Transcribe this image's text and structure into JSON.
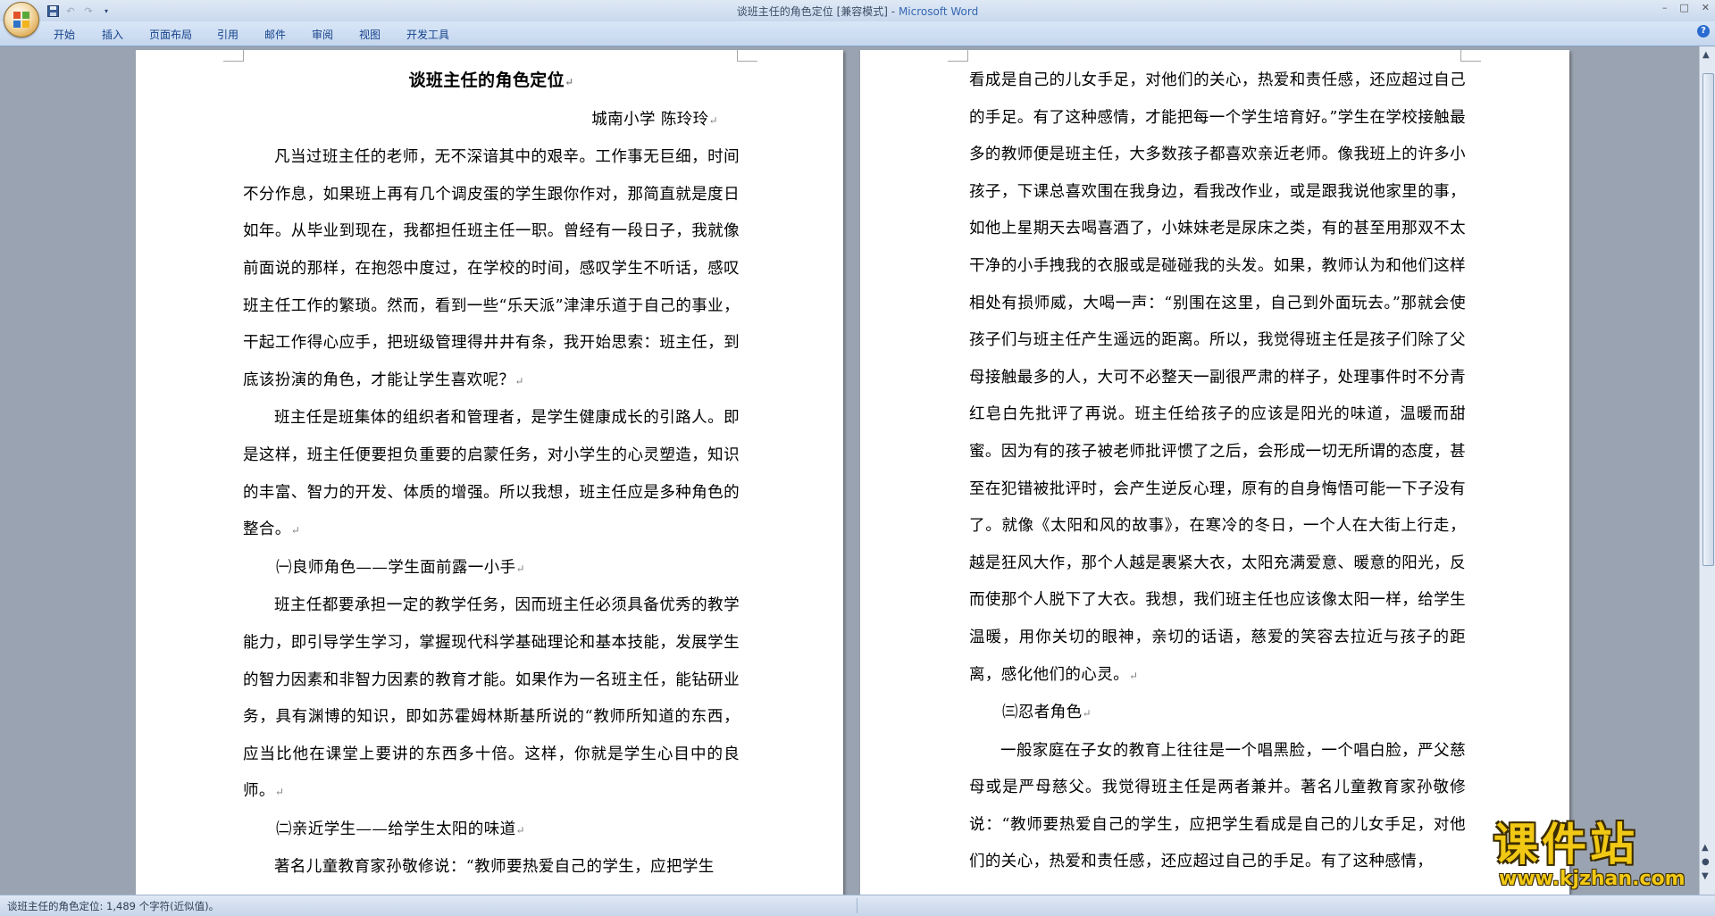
{
  "window": {
    "title_doc": "谈班主任的角色定位 [兼容模式]",
    "title_sep": " - ",
    "title_app": "Microsoft Word"
  },
  "ribbon": {
    "tabs": [
      "开始",
      "插入",
      "页面布局",
      "引用",
      "邮件",
      "审阅",
      "视图",
      "开发工具"
    ]
  },
  "quick_access": {
    "icons": [
      "save-icon",
      "undo-icon",
      "redo-icon",
      "customize-dropdown-icon"
    ]
  },
  "paragraph_mark": "↵",
  "page1": {
    "title": "谈班主任的角色定位",
    "author": "城南小学  陈玲玲",
    "para1": "凡当过班主任的老师，无不深谙其中的艰辛。工作事无巨细，时间不分作息，如果班上再有几个调皮蛋的学生跟你作对，那简直就是度日如年。从毕业到现在，我都担任班主任一职。曾经有一段日子，我就像前面说的那样，在抱怨中度过，在学校的时间，感叹学生不听话，感叹班主任工作的繁琐。然而，看到一些“乐天派”津津乐道于自己的事业，干起工作得心应手，把班级管理得井井有条，我开始思索：班主任，到底该扮演的角色，才能让学生喜欢呢？",
    "para2": "班主任是班集体的组织者和管理者，是学生健康成长的引路人。即是这样，班主任便要担负重要的启蒙任务，对小学生的心灵塑造，知识的丰富、智力的开发、体质的增强。所以我想，班主任应是多种角色的整合。",
    "heading1": "㈠良师角色——学生面前露一小手",
    "para3": "班主任都要承担一定的教学任务，因而班主任必须具备优秀的教学能力，即引导学生学习，掌握现代科学基础理论和基本技能，发展学生的智力因素和非智力因素的教育才能。如果作为一名班主任，能钻研业务，具有渊博的知识，即如苏霍姆林斯基所说的“教师所知道的东西，应当比他在课堂上要讲的东西多十倍。这样，你就是学生心目中的良师。",
    "heading2": "㈡亲近学生——给学生太阳的味道",
    "para4": "著名儿童教育家孙敬修说：“教师要热爱自己的学生，应把学生"
  },
  "page2": {
    "para1": "看成是自己的儿女手足，对他们的关心，热爱和责任感，还应超过自己的手足。有了这种感情，才能把每一个学生培育好。”学生在学校接触最多的教师便是班主任，大多数孩子都喜欢亲近老师。像我班上的许多小孩子，下课总喜欢围在我身边，看我改作业，或是跟我说他家里的事，如他上星期天去喝喜酒了，小妹妹老是尿床之类，有的甚至用那双不太干净的小手拽我的衣服或是碰碰我的头发。如果，教师认为和他们这样相处有损师威，大喝一声：“别围在这里，自己到外面玩去。”那就会使孩子们与班主任产生遥远的距离。所以，我觉得班主任是孩子们除了父母接触最多的人，大可不必整天一副很严肃的样子，处理事件时不分青红皂白先批评了再说。班主任给孩子的应该是阳光的味道，温暖而甜蜜。因为有的孩子被老师批评惯了之后，会形成一切无所谓的态度，甚至在犯错被批评时，会产生逆反心理，原有的自身悔悟可能一下子没有了。就像《太阳和风的故事》，在寒冷的冬日，一个人在大街上行走，越是狂风大作，那个人越是裹紧大衣，太阳充满爱意、暖意的阳光，反而使那个人脱下了大衣。我想，我们班主任也应该像太阳一样，给学生温暖，用你关切的眼神，亲切的话语，慈爱的笑容去拉近与孩子的距离，感化他们的心灵。",
    "heading3": "㈢忍者角色",
    "para2": "一般家庭在子女的教育上往往是一个唱黑脸，一个唱白脸，严父慈母或是严母慈父。我觉得班主任是两者兼并。著名儿童教育家孙敬修说：“教师要热爱自己的学生，应把学生看成是自己的儿女手足，对他们的关心，热爱和责任感，还应超过自己的手足。有了这种感情，"
  },
  "statusbar": {
    "text": "谈班主任的角色定位: 1,489 个字符(近似值)。"
  },
  "watermark": {
    "cn": "课件站",
    "url": "www.kjzhan.com"
  }
}
